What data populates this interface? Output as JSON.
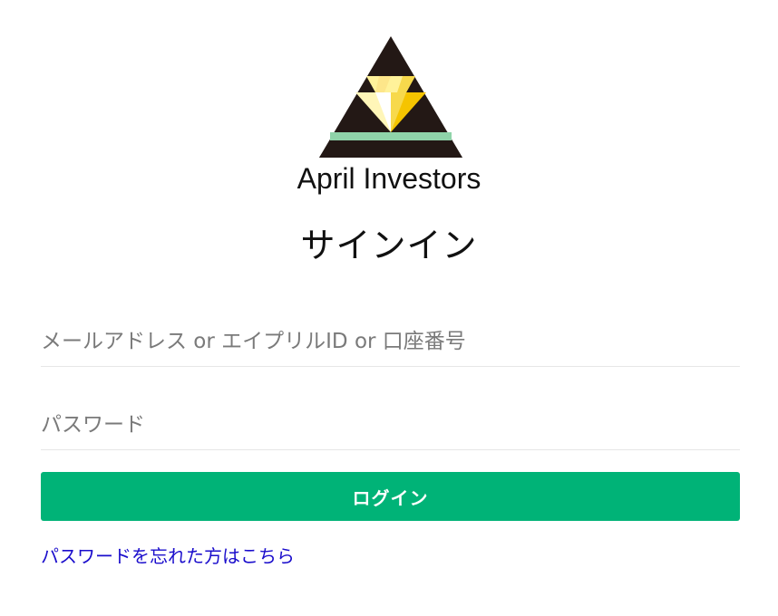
{
  "brand": {
    "name": "April Investors",
    "logo_icon": "april-investors-triangle-logo"
  },
  "form": {
    "title": "サインイン",
    "email_placeholder": "メールアドレス or エイプリルID or 口座番号",
    "email_value": "",
    "password_placeholder": "パスワード",
    "password_value": "",
    "login_label": "ログイン",
    "forgot_password_label": "パスワードを忘れた方はこちら"
  },
  "colors": {
    "primary_button": "#00b377",
    "link": "#1a0dcc",
    "logo_dark": "#231815",
    "logo_yellow": "#f5c400",
    "logo_light_yellow": "#fff29a",
    "logo_stripe": "#8fd3a9"
  }
}
